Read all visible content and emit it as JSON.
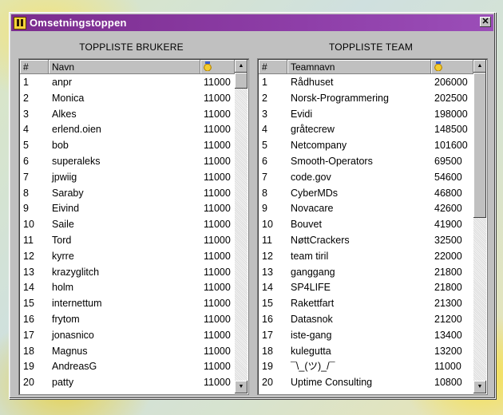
{
  "window": {
    "title": "Omsetningstoppen",
    "close_label": "✕"
  },
  "users": {
    "title": "TOPPLISTE BRUKERE",
    "headers": {
      "num": "#",
      "name": "Navn",
      "value_icon": "gold-medal-icon"
    },
    "rows": [
      {
        "rank": "1",
        "name": "anpr",
        "value": "11000"
      },
      {
        "rank": "2",
        "name": "Monica",
        "value": "11000"
      },
      {
        "rank": "3",
        "name": "Alkes",
        "value": "11000"
      },
      {
        "rank": "4",
        "name": "erlend.oien",
        "value": "11000"
      },
      {
        "rank": "5",
        "name": "bob",
        "value": "11000"
      },
      {
        "rank": "6",
        "name": "superaleks",
        "value": "11000"
      },
      {
        "rank": "7",
        "name": "jpwiig",
        "value": "11000"
      },
      {
        "rank": "8",
        "name": "Saraby",
        "value": "11000"
      },
      {
        "rank": "9",
        "name": "Eivind",
        "value": "11000"
      },
      {
        "rank": "10",
        "name": "Saile",
        "value": "11000"
      },
      {
        "rank": "11",
        "name": "Tord",
        "value": "11000"
      },
      {
        "rank": "12",
        "name": "kyrre",
        "value": "11000"
      },
      {
        "rank": "13",
        "name": "krazyglitch",
        "value": "11000"
      },
      {
        "rank": "14",
        "name": "holm",
        "value": "11000"
      },
      {
        "rank": "15",
        "name": "internettum",
        "value": "11000"
      },
      {
        "rank": "16",
        "name": "frytom",
        "value": "11000"
      },
      {
        "rank": "17",
        "name": "jonasnico",
        "value": "11000"
      },
      {
        "rank": "18",
        "name": "Magnus",
        "value": "11000"
      },
      {
        "rank": "19",
        "name": "AndreasG",
        "value": "11000"
      },
      {
        "rank": "20",
        "name": "patty",
        "value": "11000"
      }
    ]
  },
  "teams": {
    "title": "TOPPLISTE TEAM",
    "headers": {
      "num": "#",
      "name": "Teamnavn",
      "value_icon": "gold-medal-icon"
    },
    "rows": [
      {
        "rank": "1",
        "name": "Rådhuset",
        "value": "206000"
      },
      {
        "rank": "2",
        "name": "Norsk-Programmering",
        "value": "202500"
      },
      {
        "rank": "3",
        "name": "Evidi",
        "value": "198000"
      },
      {
        "rank": "4",
        "name": "gråtecrew",
        "value": "148500"
      },
      {
        "rank": "5",
        "name": "Netcompany",
        "value": "101600"
      },
      {
        "rank": "6",
        "name": "Smooth-Operators",
        "value": "69500"
      },
      {
        "rank": "7",
        "name": "code.gov",
        "value": "54600"
      },
      {
        "rank": "8",
        "name": "CyberMDs",
        "value": "46800"
      },
      {
        "rank": "9",
        "name": "Novacare",
        "value": "42600"
      },
      {
        "rank": "10",
        "name": "Bouvet",
        "value": "41900"
      },
      {
        "rank": "11",
        "name": "NøttCrackers",
        "value": "32500"
      },
      {
        "rank": "12",
        "name": "team tiril",
        "value": "22000"
      },
      {
        "rank": "13",
        "name": "ganggang",
        "value": "21800"
      },
      {
        "rank": "14",
        "name": "SP4LIFE",
        "value": "21800"
      },
      {
        "rank": "15",
        "name": "Rakettfart",
        "value": "21300"
      },
      {
        "rank": "16",
        "name": "Datasnok",
        "value": "21200"
      },
      {
        "rank": "17",
        "name": "iste-gang",
        "value": "13400"
      },
      {
        "rank": "18",
        "name": "kulegutta",
        "value": "13200"
      },
      {
        "rank": "19",
        "name": "¯\\_(ツ)_/¯",
        "value": "11000"
      },
      {
        "rank": "20",
        "name": "Uptime Consulting",
        "value": "10800"
      }
    ]
  },
  "scroll_icons": {
    "up": "▲",
    "down": "▼"
  },
  "colors": {
    "titlebar": "#7b2d8e",
    "chrome": "#c0c0c0"
  }
}
